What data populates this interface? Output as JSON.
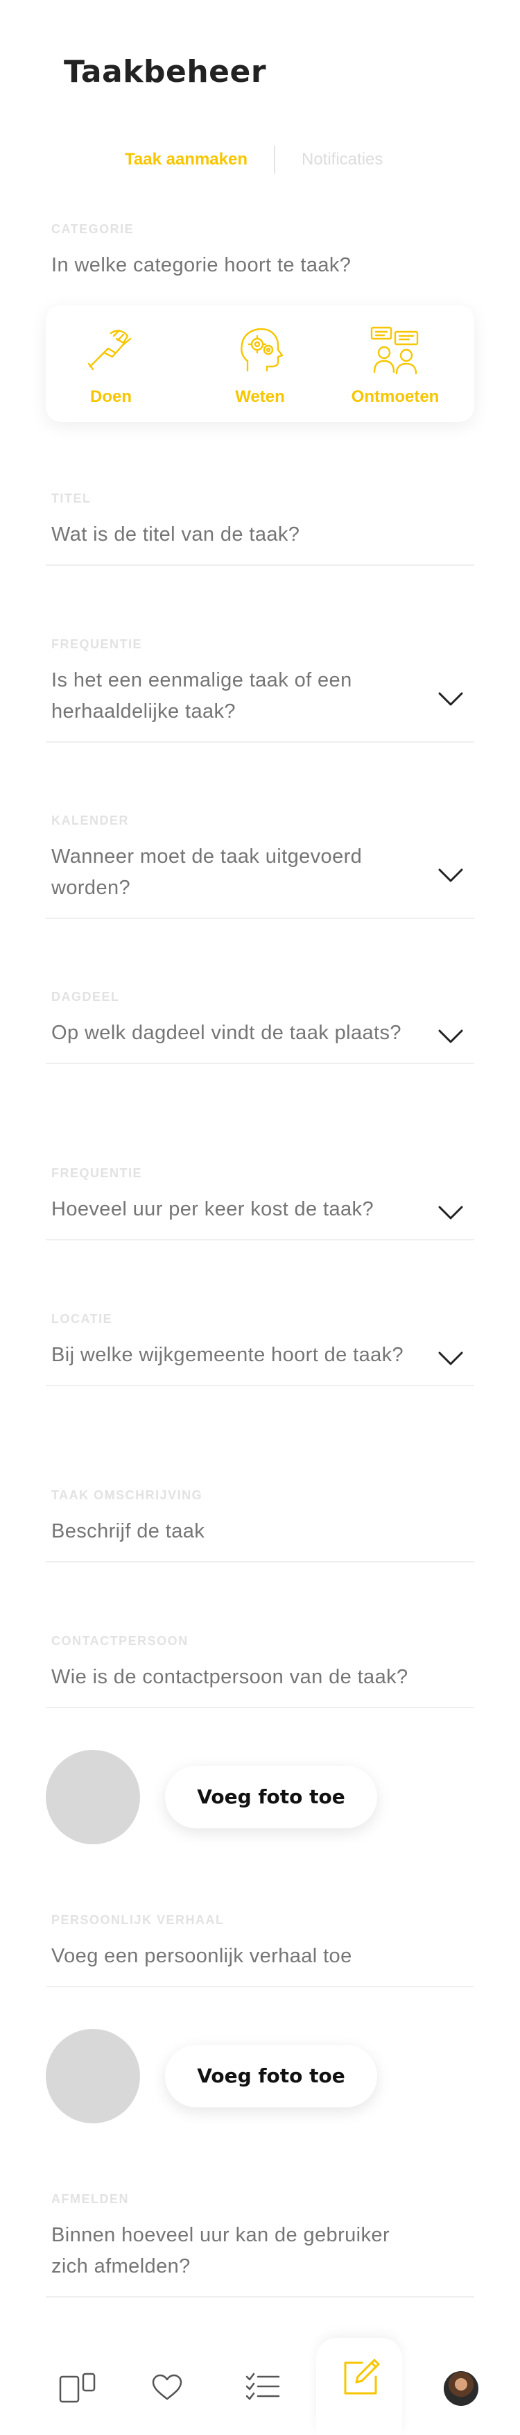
{
  "header": {
    "title": "Taakbeheer"
  },
  "tabs": [
    {
      "label": "Taak aanmaken",
      "active": true
    },
    {
      "label": "Notificaties",
      "active": false
    }
  ],
  "colors": {
    "accent": "#f7c600",
    "placeholder": "#757575",
    "label": "#e2e2e2"
  },
  "category": {
    "label": "Categorie",
    "question": "In welke categorie hoort te taak?",
    "options": [
      {
        "label": "Doen",
        "icon": "handshake-icon"
      },
      {
        "label": "Weten",
        "icon": "brain-gears-icon"
      },
      {
        "label": "Ontmoeten",
        "icon": "people-talking-icon"
      }
    ]
  },
  "fields": {
    "titel": {
      "label": "Titel",
      "placeholder": "Wat is de titel van de taak?"
    },
    "frequentie": {
      "label": "Frequentie",
      "placeholder": "Is het een eenmalige taak of een herhaaldelijke taak?"
    },
    "kalender": {
      "label": "Kalender",
      "placeholder": "Wanneer moet de taak uitgevoerd worden?"
    },
    "dagdeel": {
      "label": "Dagdeel",
      "placeholder": "Op welk dagdeel vindt de taak plaats?"
    },
    "uren": {
      "label": "Frequentie",
      "placeholder": "Hoeveel uur per keer kost de taak?"
    },
    "locatie": {
      "label": "Locatie",
      "placeholder": "Bij welke wijkgemeente hoort de taak?"
    },
    "omschrijving": {
      "label": "Taak omschrijving",
      "placeholder": "Beschrijf de taak"
    },
    "contactpersoon": {
      "label": "Contactpersoon",
      "placeholder": "Wie is de contactpersoon van de taak?"
    },
    "verhaal": {
      "label": "Persoonlijk verhaal",
      "placeholder": "Voeg een persoonlijk verhaal toe"
    },
    "afmelden": {
      "label": "Afmelden",
      "placeholder": "Binnen hoeveel uur kan de gebruiker zich afmelden?"
    }
  },
  "photo": {
    "button_label": "Voeg foto toe"
  },
  "bottom_nav": {
    "items": [
      {
        "icon": "cards-icon"
      },
      {
        "icon": "heart-icon"
      },
      {
        "icon": "checklist-icon"
      },
      {
        "icon": "edit-icon",
        "active": true
      },
      {
        "icon": "avatar"
      }
    ]
  }
}
